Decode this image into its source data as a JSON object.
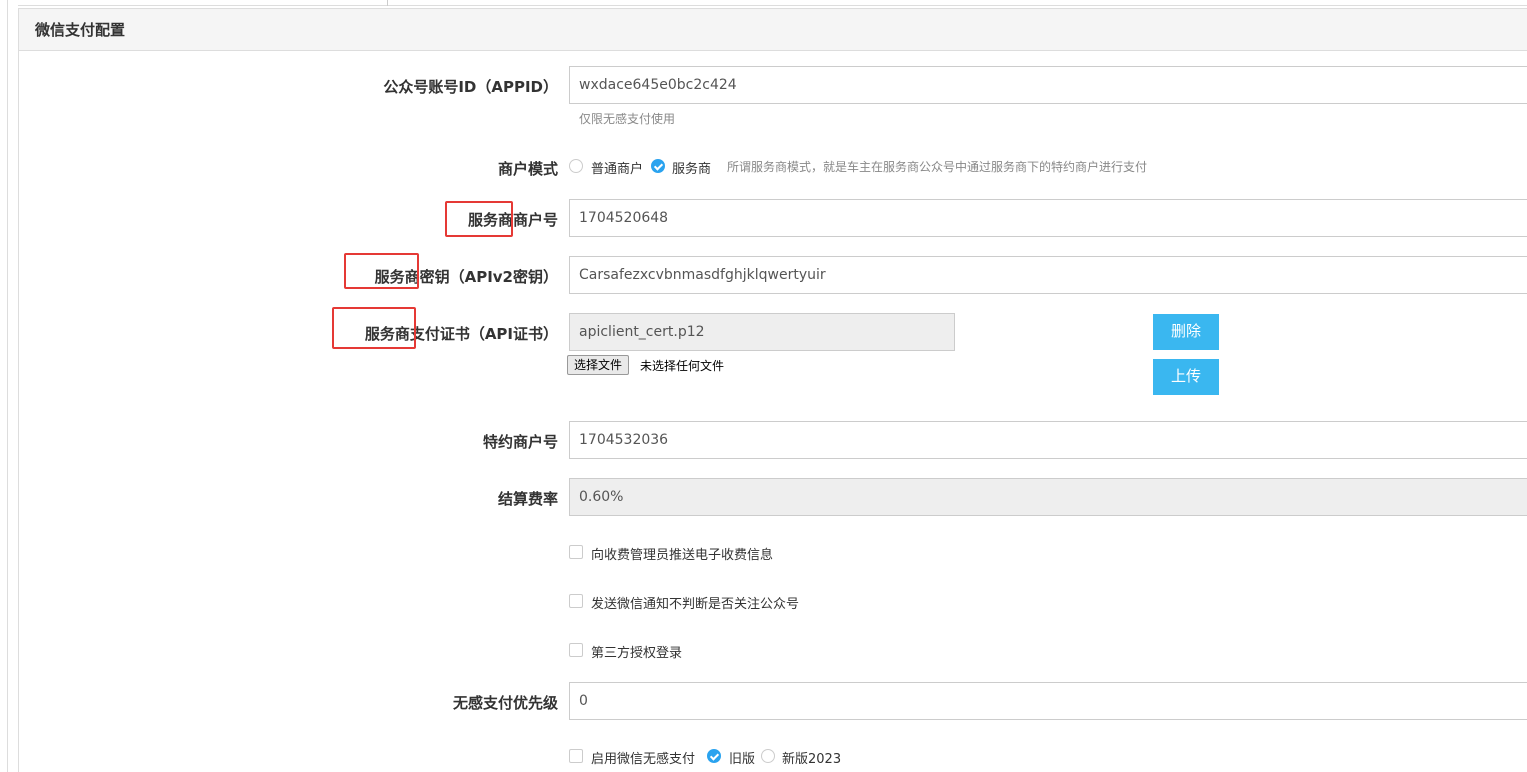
{
  "panel": {
    "title": "微信支付配置"
  },
  "appid": {
    "label": "公众号账号ID（APPID）",
    "value": "wxdace645e0bc2c424",
    "help": "仅限无感支付使用"
  },
  "merchant_mode": {
    "label": "商户模式",
    "options": [
      "普通商户",
      "服务商"
    ],
    "selected": "服务商",
    "help": "所谓服务商模式，就是车主在服务商公众号中通过服务商下的特约商户进行支付"
  },
  "sp_mchid": {
    "label": "服务商商户号",
    "value": "1704520648"
  },
  "sp_key": {
    "label": "服务商密钥（APIv2密钥）",
    "value": "Carsafezxcvbnmasdfghjklqwertyuir"
  },
  "sp_cert": {
    "label": "服务商支付证书（API证书）",
    "filename": "apiclient_cert.p12",
    "choose_label": "选择文件",
    "no_file_text": "未选择任何文件",
    "delete_label": "删除",
    "upload_label": "上传"
  },
  "sub_mchid": {
    "label": "特约商户号",
    "value": "1704532036"
  },
  "rate": {
    "label": "结算费率",
    "value": "0.60%"
  },
  "options": {
    "push_fee": "向收费管理员推送电子收费信息",
    "no_follow_check": "发送微信通知不判断是否关注公众号",
    "third_party_login": "第三方授权登录"
  },
  "priority": {
    "label": "无感支付优先级",
    "value": "0"
  },
  "nopass": {
    "label": "启用微信无感支付",
    "versions": [
      "旧版",
      "新版2023"
    ],
    "selected": "旧版"
  },
  "colors": {
    "accent": "#3ab7f0",
    "highlight": "#e53935"
  }
}
